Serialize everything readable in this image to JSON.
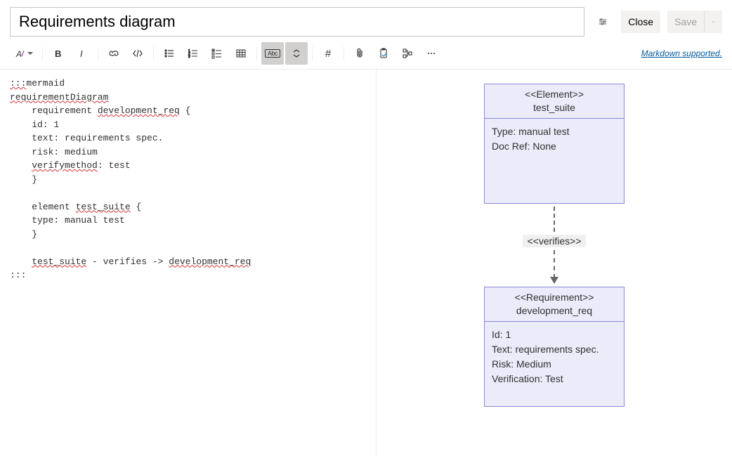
{
  "header": {
    "title": "Requirements diagram",
    "close_label": "Close",
    "save_label": "Save"
  },
  "toolbar": {
    "markdown_label": "Markdown supported.",
    "abc_label": "Abc",
    "hash_label": "#"
  },
  "editor": {
    "l1a": ":::",
    "l1b": "mermaid",
    "l2": "requirementDiagram",
    "l3a": "    requirement ",
    "l3b": "development_req",
    "l3c": " {",
    "l4": "    id: 1",
    "l5": "    text: requirements spec.",
    "l6": "    risk: medium",
    "l7a": "    ",
    "l7b": "verifymethod",
    "l7c": ": test",
    "l8": "    }",
    "l9": "",
    "l10a": "    element ",
    "l10b": "test_suite",
    "l10c": " {",
    "l11": "    type: manual test",
    "l12": "    }",
    "l13": "",
    "l14a": "    ",
    "l14b": "test_suite",
    "l14c": " - verifies -> ",
    "l14d": "development_req",
    "l15": ":::"
  },
  "diagram": {
    "node1": {
      "stereotype": "<<Element>>",
      "name": "test_suite",
      "body1": "Type: manual test",
      "body2": "Doc Ref: None"
    },
    "edge_label": "<<verifies>>",
    "node2": {
      "stereotype": "<<Requirement>>",
      "name": "development_req",
      "body1": "Id: 1",
      "body2": "Text: requirements spec.",
      "body3": "Risk: Medium",
      "body4": "Verification: Test"
    }
  }
}
